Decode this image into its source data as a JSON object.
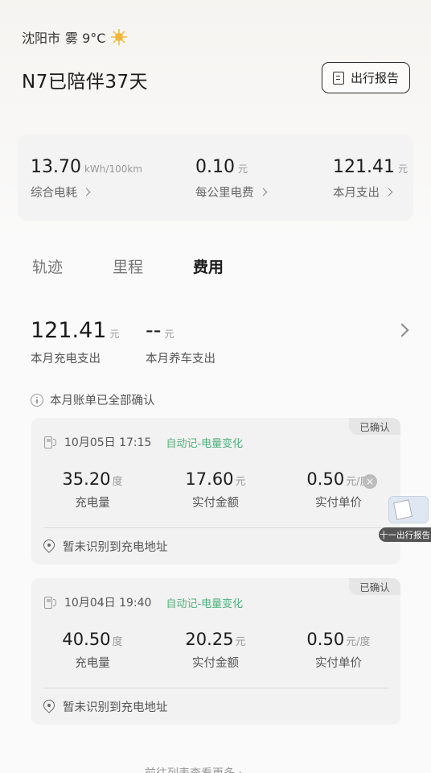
{
  "header": {
    "city": "沈阳市",
    "weather": "雾 9°C",
    "weather_icon": "sun-icon",
    "companion_text": "N7已陪伴37天",
    "report_button": "出行报告"
  },
  "stats": [
    {
      "value": "13.70",
      "unit": "kWh/100km",
      "label": "综合电耗"
    },
    {
      "value": "0.10",
      "unit": "元",
      "label": "每公里电费"
    },
    {
      "value": "121.41",
      "unit": "元",
      "label": "本月支出"
    }
  ],
  "tabs": [
    "轨迹",
    "里程",
    "费用"
  ],
  "active_tab": "费用",
  "summary": {
    "charging_value": "121.41",
    "charging_unit": "元",
    "charging_label": "本月充电支出",
    "maintenance_value": "--",
    "maintenance_unit": "元",
    "maintenance_label": "本月养车支出"
  },
  "confirm_note": "本月账单已全部确认",
  "records": [
    {
      "badge": "已确认",
      "datetime": "10月05日 17:15",
      "tag": "自动记-电量变化",
      "energy_value": "35.20",
      "energy_unit": "度",
      "energy_label": "充电量",
      "amount_value": "17.60",
      "amount_unit": "元",
      "amount_label": "实付金额",
      "price_value": "0.50",
      "price_unit": "元/度",
      "price_label": "实付单价",
      "address": "暂未识别到充电地址"
    },
    {
      "badge": "已确认",
      "datetime": "10月04日 19:40",
      "tag": "自动记-电量变化",
      "energy_value": "40.50",
      "energy_unit": "度",
      "energy_label": "充电量",
      "amount_value": "20.25",
      "amount_unit": "元",
      "amount_label": "实付金额",
      "price_value": "0.50",
      "price_unit": "元/度",
      "price_label": "实付单价",
      "address": "暂未识别到充电地址"
    }
  ],
  "float_widget": {
    "label": "十一出行报告",
    "close": "×"
  },
  "bottom_hint": "前往列表查看更多 ›"
}
